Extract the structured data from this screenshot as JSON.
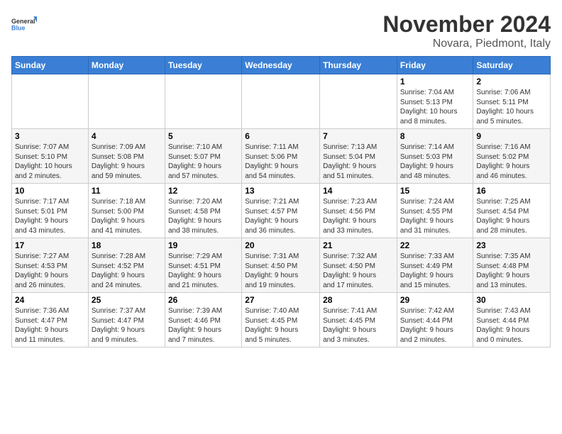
{
  "logo": {
    "line1": "General",
    "line2": "Blue"
  },
  "title": "November 2024",
  "location": "Novara, Piedmont, Italy",
  "weekdays": [
    "Sunday",
    "Monday",
    "Tuesday",
    "Wednesday",
    "Thursday",
    "Friday",
    "Saturday"
  ],
  "weeks": [
    [
      {
        "day": "",
        "info": ""
      },
      {
        "day": "",
        "info": ""
      },
      {
        "day": "",
        "info": ""
      },
      {
        "day": "",
        "info": ""
      },
      {
        "day": "",
        "info": ""
      },
      {
        "day": "1",
        "info": "Sunrise: 7:04 AM\nSunset: 5:13 PM\nDaylight: 10 hours\nand 8 minutes."
      },
      {
        "day": "2",
        "info": "Sunrise: 7:06 AM\nSunset: 5:11 PM\nDaylight: 10 hours\nand 5 minutes."
      }
    ],
    [
      {
        "day": "3",
        "info": "Sunrise: 7:07 AM\nSunset: 5:10 PM\nDaylight: 10 hours\nand 2 minutes."
      },
      {
        "day": "4",
        "info": "Sunrise: 7:09 AM\nSunset: 5:08 PM\nDaylight: 9 hours\nand 59 minutes."
      },
      {
        "day": "5",
        "info": "Sunrise: 7:10 AM\nSunset: 5:07 PM\nDaylight: 9 hours\nand 57 minutes."
      },
      {
        "day": "6",
        "info": "Sunrise: 7:11 AM\nSunset: 5:06 PM\nDaylight: 9 hours\nand 54 minutes."
      },
      {
        "day": "7",
        "info": "Sunrise: 7:13 AM\nSunset: 5:04 PM\nDaylight: 9 hours\nand 51 minutes."
      },
      {
        "day": "8",
        "info": "Sunrise: 7:14 AM\nSunset: 5:03 PM\nDaylight: 9 hours\nand 48 minutes."
      },
      {
        "day": "9",
        "info": "Sunrise: 7:16 AM\nSunset: 5:02 PM\nDaylight: 9 hours\nand 46 minutes."
      }
    ],
    [
      {
        "day": "10",
        "info": "Sunrise: 7:17 AM\nSunset: 5:01 PM\nDaylight: 9 hours\nand 43 minutes."
      },
      {
        "day": "11",
        "info": "Sunrise: 7:18 AM\nSunset: 5:00 PM\nDaylight: 9 hours\nand 41 minutes."
      },
      {
        "day": "12",
        "info": "Sunrise: 7:20 AM\nSunset: 4:58 PM\nDaylight: 9 hours\nand 38 minutes."
      },
      {
        "day": "13",
        "info": "Sunrise: 7:21 AM\nSunset: 4:57 PM\nDaylight: 9 hours\nand 36 minutes."
      },
      {
        "day": "14",
        "info": "Sunrise: 7:23 AM\nSunset: 4:56 PM\nDaylight: 9 hours\nand 33 minutes."
      },
      {
        "day": "15",
        "info": "Sunrise: 7:24 AM\nSunset: 4:55 PM\nDaylight: 9 hours\nand 31 minutes."
      },
      {
        "day": "16",
        "info": "Sunrise: 7:25 AM\nSunset: 4:54 PM\nDaylight: 9 hours\nand 28 minutes."
      }
    ],
    [
      {
        "day": "17",
        "info": "Sunrise: 7:27 AM\nSunset: 4:53 PM\nDaylight: 9 hours\nand 26 minutes."
      },
      {
        "day": "18",
        "info": "Sunrise: 7:28 AM\nSunset: 4:52 PM\nDaylight: 9 hours\nand 24 minutes."
      },
      {
        "day": "19",
        "info": "Sunrise: 7:29 AM\nSunset: 4:51 PM\nDaylight: 9 hours\nand 21 minutes."
      },
      {
        "day": "20",
        "info": "Sunrise: 7:31 AM\nSunset: 4:50 PM\nDaylight: 9 hours\nand 19 minutes."
      },
      {
        "day": "21",
        "info": "Sunrise: 7:32 AM\nSunset: 4:50 PM\nDaylight: 9 hours\nand 17 minutes."
      },
      {
        "day": "22",
        "info": "Sunrise: 7:33 AM\nSunset: 4:49 PM\nDaylight: 9 hours\nand 15 minutes."
      },
      {
        "day": "23",
        "info": "Sunrise: 7:35 AM\nSunset: 4:48 PM\nDaylight: 9 hours\nand 13 minutes."
      }
    ],
    [
      {
        "day": "24",
        "info": "Sunrise: 7:36 AM\nSunset: 4:47 PM\nDaylight: 9 hours\nand 11 minutes."
      },
      {
        "day": "25",
        "info": "Sunrise: 7:37 AM\nSunset: 4:47 PM\nDaylight: 9 hours\nand 9 minutes."
      },
      {
        "day": "26",
        "info": "Sunrise: 7:39 AM\nSunset: 4:46 PM\nDaylight: 9 hours\nand 7 minutes."
      },
      {
        "day": "27",
        "info": "Sunrise: 7:40 AM\nSunset: 4:45 PM\nDaylight: 9 hours\nand 5 minutes."
      },
      {
        "day": "28",
        "info": "Sunrise: 7:41 AM\nSunset: 4:45 PM\nDaylight: 9 hours\nand 3 minutes."
      },
      {
        "day": "29",
        "info": "Sunrise: 7:42 AM\nSunset: 4:44 PM\nDaylight: 9 hours\nand 2 minutes."
      },
      {
        "day": "30",
        "info": "Sunrise: 7:43 AM\nSunset: 4:44 PM\nDaylight: 9 hours\nand 0 minutes."
      }
    ]
  ]
}
